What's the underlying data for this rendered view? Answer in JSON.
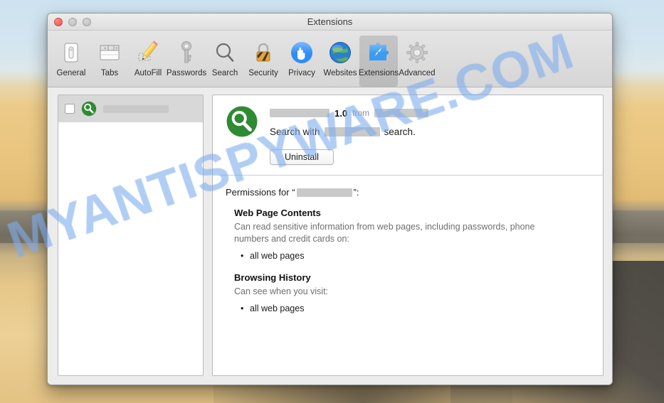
{
  "window": {
    "title": "Extensions",
    "traffic_lights": [
      "close",
      "minimize",
      "zoom"
    ]
  },
  "toolbar": {
    "items": [
      {
        "label": "General",
        "icon": "general-switch-icon",
        "selected": false
      },
      {
        "label": "Tabs",
        "icon": "tabs-icon",
        "selected": false
      },
      {
        "label": "AutoFill",
        "icon": "autofill-pencil-icon",
        "selected": false
      },
      {
        "label": "Passwords",
        "icon": "key-icon",
        "selected": false
      },
      {
        "label": "Search",
        "icon": "magnifier-icon",
        "selected": false
      },
      {
        "label": "Security",
        "icon": "lock-icon",
        "selected": false
      },
      {
        "label": "Privacy",
        "icon": "hand-icon",
        "selected": false
      },
      {
        "label": "Websites",
        "icon": "globe-icon",
        "selected": false
      },
      {
        "label": "Extensions",
        "icon": "puzzle-compass-icon",
        "selected": true
      },
      {
        "label": "Advanced",
        "icon": "gear-icon",
        "selected": false
      }
    ]
  },
  "sidebar": {
    "rows": [
      {
        "icon": "green-magnifier-icon",
        "name_redacted": true,
        "checked": false,
        "selected": true
      }
    ]
  },
  "detail": {
    "icon": "green-magnifier-icon",
    "name_redacted": true,
    "version": "1.0",
    "from_label": "from",
    "publisher_redacted": true,
    "description_prefix": "Search with",
    "description_suffix": "search.",
    "uninstall_label": "Uninstall"
  },
  "permissions": {
    "title_prefix": "Permissions for “",
    "title_suffix": "”:",
    "groups": [
      {
        "heading": "Web Page Contents",
        "description": "Can read sensitive information from web pages, including passwords, phone numbers and credit cards on:",
        "items": [
          "all web pages"
        ]
      },
      {
        "heading": "Browsing History",
        "description": "Can see when you visit:",
        "items": [
          "all web pages"
        ]
      }
    ]
  },
  "watermark": {
    "text": "MYANTISPYWARE.COM"
  },
  "colors": {
    "accent_green": "#2e8b33",
    "selected_tab": "rgba(0,0,0,0.13)",
    "redaction_gray": "#c9c9c9",
    "watermark_blue": "#78a8eb"
  }
}
